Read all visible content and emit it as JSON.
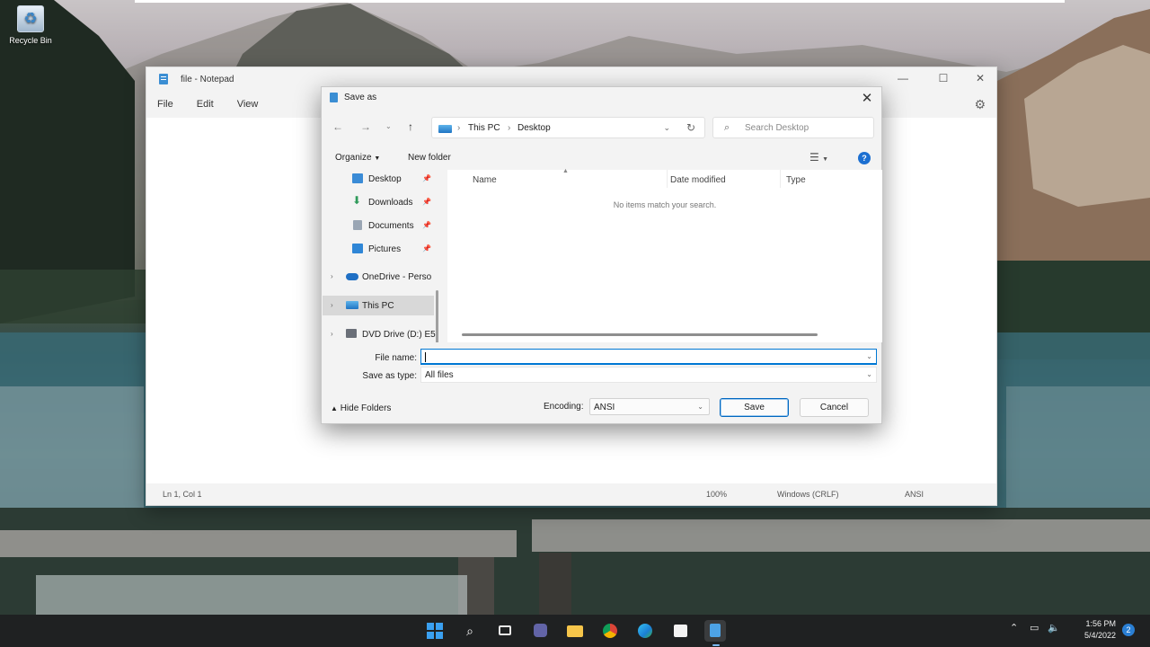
{
  "desktop": {
    "recycle_bin_label": "Recycle Bin"
  },
  "notepad": {
    "title": "file - Notepad",
    "menu": [
      "File",
      "Edit",
      "View"
    ],
    "status": {
      "position": "Ln 1, Col 1",
      "zoom": "100%",
      "line_endings": "Windows (CRLF)",
      "encoding": "ANSI"
    }
  },
  "save_dialog": {
    "title": "Save as",
    "address": {
      "location": "This PC",
      "folder": "Desktop"
    },
    "search_placeholder": "Search Desktop",
    "toolbar": {
      "organize": "Organize",
      "new_folder": "New folder"
    },
    "nav_items": [
      {
        "label": "Desktop",
        "icon": "desktop-folder-icon",
        "pinned": true
      },
      {
        "label": "Downloads",
        "icon": "downloads-icon",
        "pinned": true
      },
      {
        "label": "Documents",
        "icon": "documents-icon",
        "pinned": true
      },
      {
        "label": "Pictures",
        "icon": "pictures-icon",
        "pinned": true
      },
      {
        "label": "OneDrive - Perso",
        "icon": "onedrive-icon",
        "expandable": true
      },
      {
        "label": "This PC",
        "icon": "this-pc-icon",
        "expandable": true,
        "selected": true
      },
      {
        "label": "DVD Drive (D:) E5",
        "icon": "dvd-drive-icon",
        "expandable": true
      }
    ],
    "columns": [
      "Name",
      "Date modified",
      "Type"
    ],
    "empty_message": "No items match your search.",
    "file_name_label": "File name:",
    "file_name_value": "",
    "save_as_type_label": "Save as type:",
    "save_as_type_value": "All files",
    "hide_folders": "Hide Folders",
    "encoding_label": "Encoding:",
    "encoding_value": "ANSI",
    "save_button": "Save",
    "cancel_button": "Cancel"
  },
  "taskbar": {
    "apps": [
      "start-icon",
      "search-icon",
      "task-view-icon",
      "teams-chat-icon",
      "file-explorer-icon",
      "chrome-icon",
      "edge-icon",
      "store-icon",
      "notepad-icon"
    ],
    "time": "1:56 PM",
    "date": "5/4/2022",
    "notification_count": "2"
  },
  "colors": {
    "accent": "#0078d4",
    "taskbar": "#1f2122",
    "dialog_bg": "#f3f3f3"
  }
}
